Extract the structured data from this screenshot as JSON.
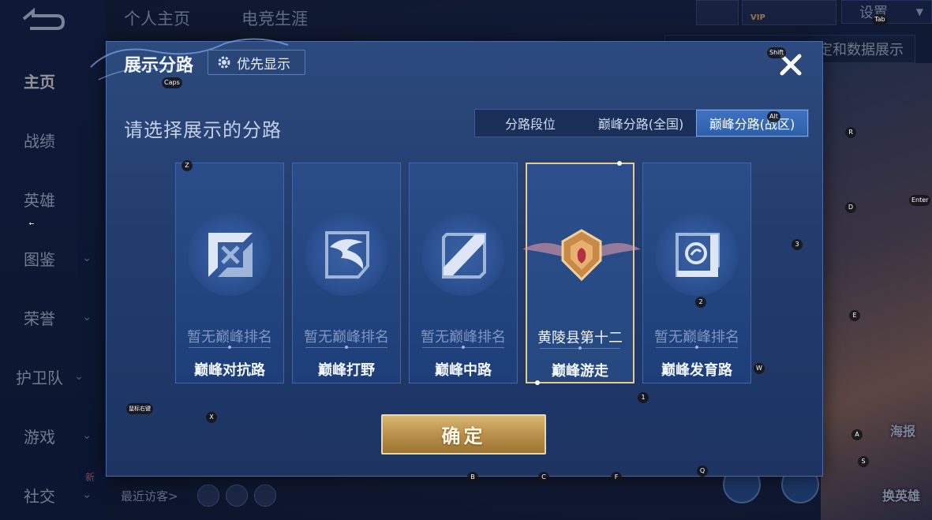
{
  "background": {
    "top_tabs": [
      "个人主页",
      "电竞生涯"
    ],
    "sidebar": [
      {
        "label": "主页",
        "active": true,
        "chevron": false
      },
      {
        "label": "战绩",
        "active": false,
        "chevron": false
      },
      {
        "label": "英雄",
        "active": false,
        "chevron": false
      },
      {
        "label": "图鉴",
        "active": false,
        "chevron": true
      },
      {
        "label": "荣誉",
        "active": false,
        "chevron": true
      },
      {
        "label": "护卫队",
        "active": false,
        "chevron": true
      },
      {
        "label": "游戏",
        "active": false,
        "chevron": true
      },
      {
        "label": "社交",
        "active": false,
        "chevron": true
      }
    ],
    "new_badge": "新",
    "settings_label": "设置",
    "vip_badge": "VIP",
    "right_banner_text": "定和数据展示",
    "recent_visitors_label": "最近访客>",
    "side_button_top": "海报",
    "side_button_bottom": "换英雄"
  },
  "dialog": {
    "title": "展示分路",
    "priority_button_label": "优先显示",
    "subtitle": "请选择展示的分路",
    "tabs": [
      {
        "label": "分路段位",
        "active": false
      },
      {
        "label": "巅峰分路(全国)",
        "active": false
      },
      {
        "label": "巅峰分路(战区)",
        "active": true
      }
    ],
    "cards": [
      {
        "name": "巅峰对抗路",
        "rank": "暂无巅峰排名",
        "selected": false,
        "icon": "clash-lane-icon"
      },
      {
        "name": "巅峰打野",
        "rank": "暂无巅峰排名",
        "selected": false,
        "icon": "jungle-dragon-icon"
      },
      {
        "name": "巅峰中路",
        "rank": "暂无巅峰排名",
        "selected": false,
        "icon": "mid-lane-icon"
      },
      {
        "name": "巅峰游走",
        "rank": "黄陵县第十二",
        "selected": true,
        "icon": "roam-badge-icon"
      },
      {
        "name": "巅峰发育路",
        "rank": "暂无巅峰排名",
        "selected": false,
        "icon": "farm-lane-icon"
      }
    ],
    "confirm_label": "确定"
  },
  "keyboard_hints": [
    "Caps",
    "Shift",
    "Tab",
    "Alt",
    "R",
    "Z",
    "Enter",
    "D",
    "3",
    "2",
    "E",
    "W",
    "1",
    "X",
    "A",
    "S",
    "B",
    "C",
    "F",
    "Q",
    "←",
    "鼠标右键"
  ],
  "colors": {
    "accent_gold": "#e8c98a",
    "tab_active": "#3e73c2",
    "dialog_bg": "#223c6c"
  }
}
